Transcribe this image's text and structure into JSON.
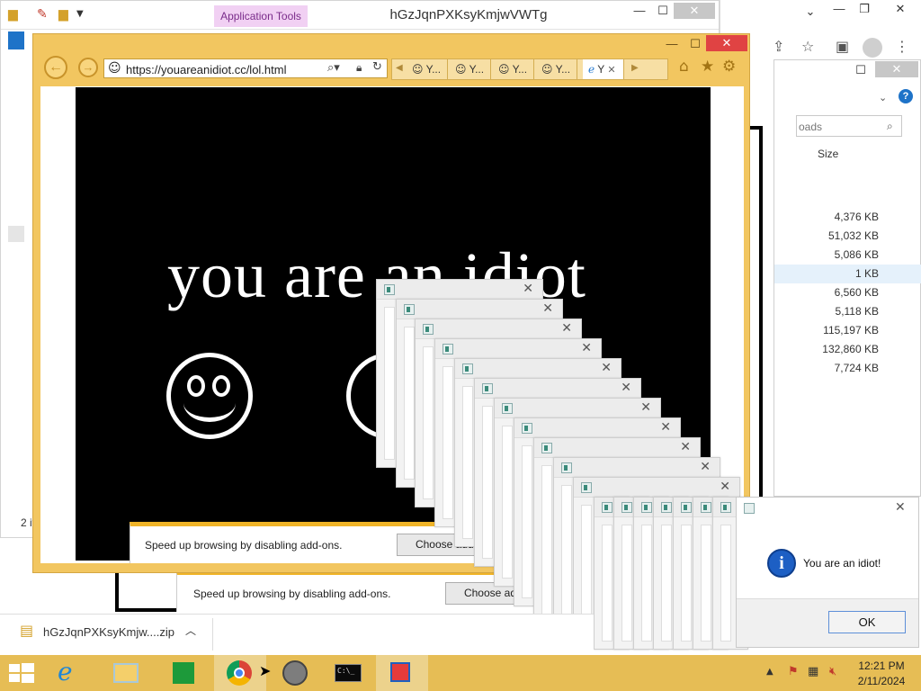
{
  "explorer": {
    "context_tab": "Application Tools",
    "title": "hGzJqnPXKsyKmjwVWTg",
    "status": "2 it"
  },
  "files": {
    "search_placeholder": "oads",
    "size_header": "Size",
    "sizes": [
      "4,376 KB",
      "51,032 KB",
      "5,086 KB",
      "1 KB",
      "6,560 KB",
      "5,118 KB",
      "115,197 KB",
      "132,860 KB",
      "7,724 KB"
    ]
  },
  "ie": {
    "url": "https://youareanidiot.cc/lol.html",
    "tabs": [
      "Y...",
      "Y...",
      "Y...",
      "Y..."
    ],
    "active_tab": "Y"
  },
  "page": {
    "headline": "you are an idiot"
  },
  "notifications": [
    {
      "message": "Speed up browsing by disabling add-ons.",
      "button": "Choose add-ons"
    },
    {
      "message": "Speed up browsing by disabling add-ons.",
      "button": "Choose add-ons"
    }
  ],
  "dialog": {
    "message": "You are an idiot!",
    "ok": "OK"
  },
  "download": {
    "filename": "hGzJqnPXKsyKmjw....zip"
  },
  "taskbar": {
    "time": "12:21 PM",
    "date": "2/11/2024",
    "cmd_label": "C:\\_"
  }
}
